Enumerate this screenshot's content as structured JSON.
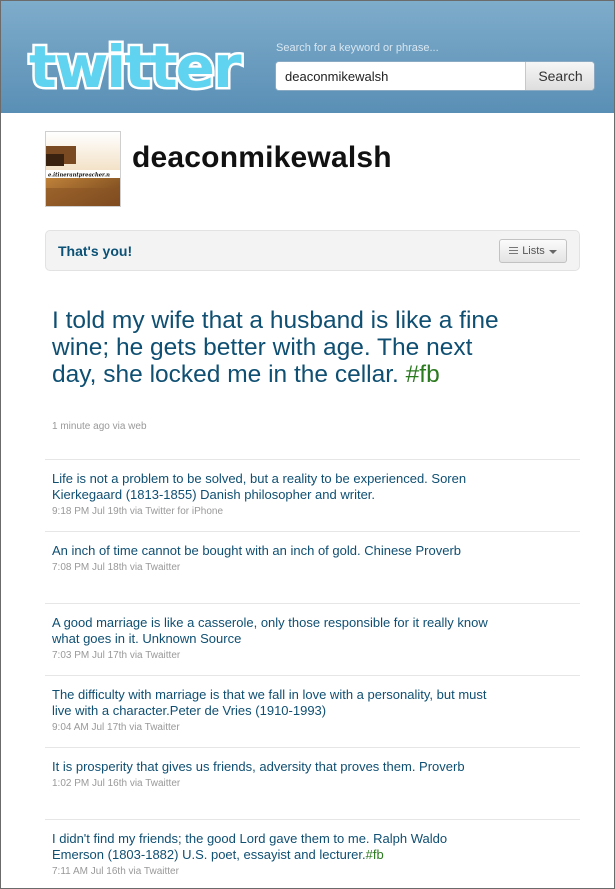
{
  "header": {
    "logo_text": "twitter",
    "search_hint": "Search for a keyword or phrase...",
    "search_value": "deaconmikewalsh",
    "search_button": "Search"
  },
  "profile": {
    "name": "deaconmikewalsh",
    "avatar_caption": "e.itinerantpreacher.n"
  },
  "you_bar": {
    "label": "That's you!",
    "lists_button": "Lists"
  },
  "main_tweet": {
    "text": "I told my wife that a husband is like a fine wine; he gets better with age. The next day, she locked me in the cellar.",
    "hashtag": "#fb",
    "meta": "1 minute ago via web"
  },
  "tweets": [
    {
      "text": "Life is not a problem to be solved, but a reality to be experienced. Soren Kierkegaard (1813-1855) Danish philosopher and writer.",
      "hashtag": "",
      "meta": "9:18 PM Jul 19th via Twitter for iPhone"
    },
    {
      "text": "An inch of time cannot be bought with an inch of gold. Chinese Proverb",
      "hashtag": "",
      "meta": "7:08 PM Jul 18th via Twaitter"
    },
    {
      "text": "A good marriage is like a casserole, only those responsible for it really know what goes in it. Unknown Source",
      "hashtag": "",
      "meta": "7:03 PM Jul 17th via Twaitter"
    },
    {
      "text": "The difficulty with marriage is that we fall in love with a personality, but must live with a character.Peter de Vries (1910-1993)",
      "hashtag": "",
      "meta": "9:04 AM Jul 17th via Twaitter"
    },
    {
      "text": "It is prosperity that gives us friends, adversity that proves them. Proverb",
      "hashtag": "",
      "meta": "1:02 PM Jul 16th via Twaitter"
    },
    {
      "text": "I didn't find my friends; the good Lord gave them to me. Ralph Waldo Emerson (1803-1882) U.S. poet, essayist and lecturer.",
      "hashtag": "#fb",
      "meta": "7:11 AM Jul 16th via Twaitter"
    }
  ],
  "colors": {
    "header_top": "#7eaccb",
    "header_bottom": "#5a8fb5",
    "logo_fill": "#5fd3ef",
    "tweet_text": "#0f4f72",
    "hashtag": "#2b7a20"
  }
}
